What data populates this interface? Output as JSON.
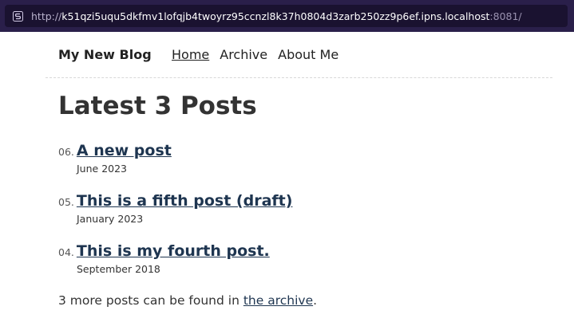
{
  "browser": {
    "url_scheme": "http://",
    "url_host": "k51qzi5uqu5dkfmv1lofqjb4twoyrz95ccnzl8k37h0804d3zarb250zz9p6ef.ipns.localhost",
    "url_port": ":8081/",
    "site_icon": "site-favicon-icon"
  },
  "header": {
    "site_title": "My New Blog",
    "nav": [
      "Home",
      "Archive",
      "About Me"
    ]
  },
  "main": {
    "title": "Latest 3 Posts",
    "posts": [
      {
        "number": "06.",
        "title": "A new post",
        "date": "June 2023"
      },
      {
        "number": "05.",
        "title": "This is a fifth post (draft)",
        "date": "January 2023"
      },
      {
        "number": "04.",
        "title": "This is my fourth post.",
        "date": "September 2018"
      }
    ],
    "more_prefix": "3 more posts can be found in",
    "more_link": "the archive",
    "more_suffix": "."
  },
  "colors": {
    "browser_bar": "#2a1f4a",
    "link": "#1e3550",
    "text": "#333333"
  }
}
